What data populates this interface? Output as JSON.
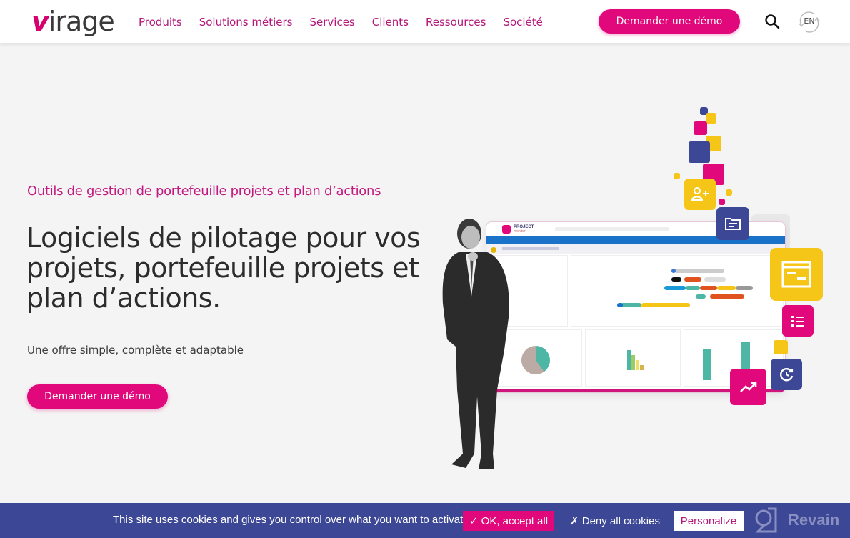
{
  "header": {
    "logo_accent": "v",
    "logo_rest": "irage",
    "nav": [
      {
        "label": "Produits"
      },
      {
        "label": "Solutions métiers"
      },
      {
        "label": "Services"
      },
      {
        "label": "Clients"
      },
      {
        "label": "Ressources"
      },
      {
        "label": "Société"
      }
    ],
    "demo_button": "Demander une démo",
    "search_icon": "search-icon",
    "language": "EN"
  },
  "hero": {
    "kicker": "Outils de gestion de portefeuille projets et plan d’actions",
    "headline": "Logiciels de pilotage pour vos projets, portefeuille projets et plan d’actions.",
    "subline": "Une offre simple, complète et adaptable",
    "demo_button": "Demander une démo"
  },
  "illustration": {
    "mockup_brand": "PROJECT",
    "mockup_brand_sub": "monitor",
    "icons": [
      "add-user-icon",
      "folder-icon",
      "gantt-window-icon",
      "numbered-list-icon",
      "trend-up-icon",
      "history-icon"
    ]
  },
  "cookie_bar": {
    "message": "This site uses cookies and gives you control over what you want to activate",
    "accept": "✓ OK, accept all",
    "deny": "✗ Deny all cookies",
    "personalize": "Personalize",
    "watermark": "Revain"
  },
  "colors": {
    "brand_pink": "#e0087a",
    "nav_pink": "#b3177a",
    "navy": "#3c4795",
    "yellow": "#f5c518",
    "teal": "#4db6a4",
    "background": "#f4f4f4"
  }
}
